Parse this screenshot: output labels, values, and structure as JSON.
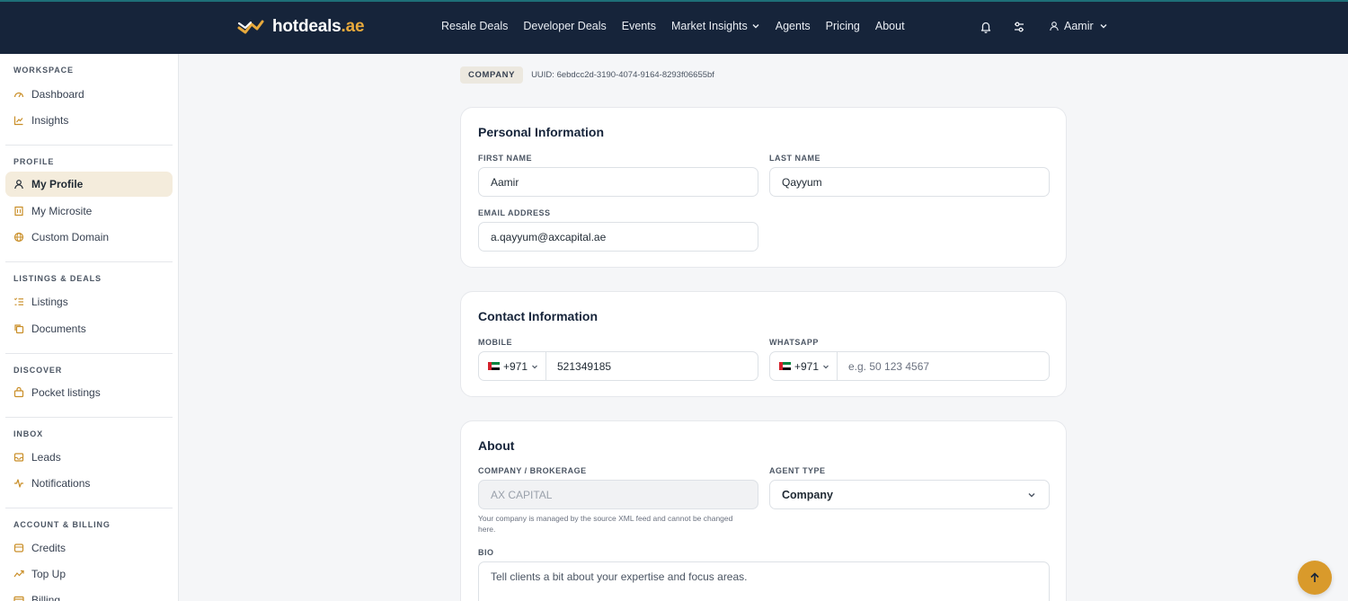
{
  "brand": {
    "name": "hotdeals",
    "tld": ".ae",
    "accent": "#e7a93c",
    "navbar_color": "#16243a"
  },
  "nav": {
    "items": [
      "Resale Deals",
      "Developer Deals",
      "Events",
      "Market Insights",
      "Agents",
      "Pricing",
      "About"
    ],
    "user_name": "Aamir"
  },
  "sidebar": {
    "sections": [
      {
        "heading": "WORKSPACE",
        "items": [
          {
            "label": "Dashboard",
            "icon": "gauge-icon"
          },
          {
            "label": "Insights",
            "icon": "chart-line-icon"
          }
        ]
      },
      {
        "heading": "PROFILE",
        "items": [
          {
            "label": "My Profile",
            "icon": "user-icon",
            "active": true
          },
          {
            "label": "My Microsite",
            "icon": "building-icon"
          },
          {
            "label": "Custom Domain",
            "icon": "globe-icon"
          }
        ]
      },
      {
        "heading": "LISTINGS & DEALS",
        "items": [
          {
            "label": "Listings",
            "icon": "list-icon"
          },
          {
            "label": "Documents",
            "icon": "copy-icon"
          }
        ]
      },
      {
        "heading": "DISCOVER",
        "items": [
          {
            "label": "Pocket listings",
            "icon": "bag-icon"
          }
        ]
      },
      {
        "heading": "INBOX",
        "items": [
          {
            "label": "Leads",
            "icon": "inbox-icon"
          },
          {
            "label": "Notifications",
            "icon": "activity-icon"
          }
        ]
      },
      {
        "heading": "ACCOUNT & BILLING",
        "items": [
          {
            "label": "Credits",
            "icon": "coins-icon"
          },
          {
            "label": "Top Up",
            "icon": "arrow-up-icon"
          },
          {
            "label": "Billing",
            "icon": "card-icon"
          }
        ]
      }
    ]
  },
  "profile": {
    "badge": "COMPANY",
    "uuid": "UUID: 6ebdcc2d-3190-4074-9164-8293f06655bf"
  },
  "personal": {
    "title": "Personal Information",
    "first_name_label": "FIRST NAME",
    "first_name": "Aamir",
    "last_name_label": "LAST NAME",
    "last_name": "Qayyum",
    "email_label": "EMAIL ADDRESS",
    "email": "a.qayyum@axcapital.ae"
  },
  "contact": {
    "title": "Contact Information",
    "mobile_label": "MOBILE",
    "mobile_code": "+971",
    "mobile_number": "521349185",
    "whatsapp_label": "WHATSAPP",
    "whatsapp_code": "+971",
    "whatsapp_placeholder": "e.g. 50 123 4567"
  },
  "about": {
    "title": "About",
    "company_label": "COMPANY / BROKERAGE",
    "company_value": "AX CAPITAL",
    "company_hint": "Your company is managed by the source XML feed and cannot be changed here.",
    "agent_type_label": "AGENT TYPE",
    "agent_type_value": "Company",
    "bio_label": "BIO",
    "bio_placeholder": "Tell clients a bit about your expertise and focus areas."
  }
}
